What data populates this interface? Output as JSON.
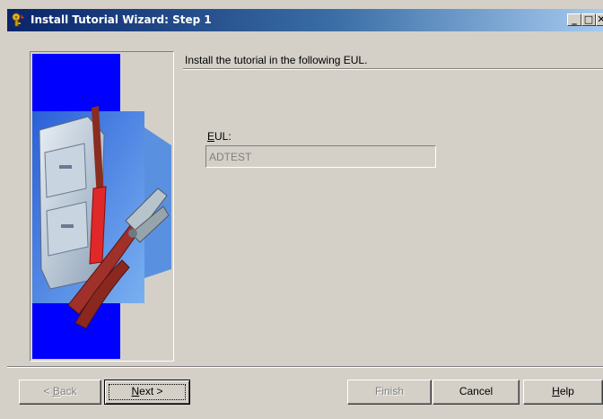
{
  "window": {
    "title": "Install Tutorial Wizard: Step 1",
    "controls": {
      "minimize": "_",
      "maximize": "□",
      "close": "✕"
    }
  },
  "header": {
    "instruction": "Install the tutorial in the following EUL."
  },
  "form": {
    "eul_label_mnemonic": "E",
    "eul_label_rest": "UL:",
    "eul_value": "ADTEST"
  },
  "buttons": {
    "back_mnemonic": "B",
    "back_prefix": "< ",
    "back_rest": "ack",
    "next_mnemonic": "N",
    "next_rest": "ext >",
    "finish": "Finish",
    "cancel": "Cancel",
    "help_mnemonic": "H",
    "help_rest": "elp"
  },
  "icons": {
    "title": "wizard-key-icon",
    "side": "filing-cabinet-tools-illustration"
  },
  "colors": {
    "titlebar_start": "#0a246a",
    "titlebar_end": "#a6caf0",
    "face": "#d4d0c8",
    "art_blue": "#0000ff"
  }
}
